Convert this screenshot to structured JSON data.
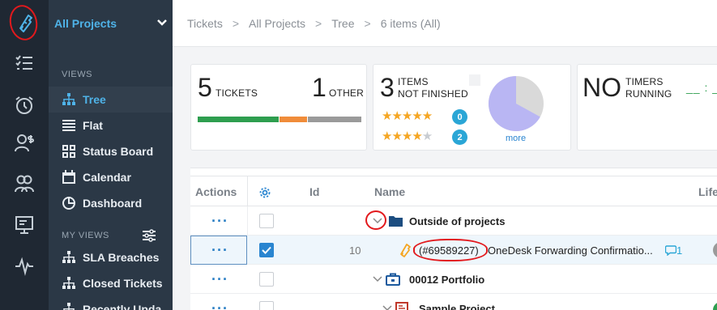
{
  "rail": {
    "items": [
      "tickets-icon",
      "tasks-icon",
      "timers-icon",
      "billing-icon",
      "customers-icon",
      "presentation-icon",
      "activity-icon"
    ]
  },
  "nav": {
    "header": "All Projects",
    "views_heading": "VIEWS",
    "views": [
      {
        "label": "Tree",
        "icon": "tree-icon",
        "active": true
      },
      {
        "label": "Flat",
        "icon": "list-icon"
      },
      {
        "label": "Status Board",
        "icon": "board-icon"
      },
      {
        "label": "Calendar",
        "icon": "calendar-icon"
      },
      {
        "label": "Dashboard",
        "icon": "dashboard-icon"
      }
    ],
    "my_views_heading": "MY VIEWS",
    "my_views": [
      {
        "label": "SLA Breaches",
        "icon": "tree-icon"
      },
      {
        "label": "Closed Tickets",
        "icon": "tree-icon"
      },
      {
        "label": "Recently Upda",
        "icon": "tree-icon"
      }
    ]
  },
  "breadcrumb": {
    "items": [
      "Tickets",
      "All Projects",
      "Tree"
    ],
    "current": "6 items (All)"
  },
  "summary": {
    "tickets_num": "5",
    "tickets_label": "TICKETS",
    "other_num": "1",
    "other_label": "OTHER",
    "progress": [
      {
        "fraction": 0.5,
        "color": "#2e9e4f"
      },
      {
        "fraction": 0.17,
        "color": "#f08c3a"
      },
      {
        "fraction": 0.33,
        "color": "#9a9a9a"
      }
    ],
    "not_finished_num": "3",
    "not_finished_label1": "ITEMS",
    "not_finished_label2": "NOT FINISHED",
    "rating_rows": [
      {
        "stars": 5,
        "filled": 5,
        "count": "0"
      },
      {
        "stars": 5,
        "filled": 4,
        "count": "2"
      }
    ],
    "pie_fraction_purple": 0.67,
    "pie_colors": {
      "main": "#b9b6f3",
      "rest": "#d9d9d9"
    },
    "more_label": "more",
    "timers_num": "NO",
    "timers_label1": "TIMERS",
    "timers_label2": "RUNNING",
    "timer_display": "__ : __"
  },
  "table": {
    "headers": {
      "actions": "Actions",
      "id": "Id",
      "name": "Name",
      "life": "Life"
    },
    "rows": [
      {
        "id": "",
        "name": "Outside of projects",
        "icon": "folder-icon",
        "bold": true,
        "checked": false,
        "expanded": true
      },
      {
        "id": "10",
        "ref": "(#69589227)",
        "name": "OneDesk Forwarding Confirmatio...",
        "icon": "ticket-icon",
        "checked": true,
        "selected": true,
        "comments": "1"
      },
      {
        "id": "",
        "name": "00012 Portfolio",
        "icon": "portfolio-icon",
        "bold": true,
        "checked": false,
        "expanded": true
      },
      {
        "id": "",
        "name": "Sample Project",
        "icon": "project-icon",
        "bold": true,
        "checked": false,
        "expanded": true
      }
    ]
  }
}
